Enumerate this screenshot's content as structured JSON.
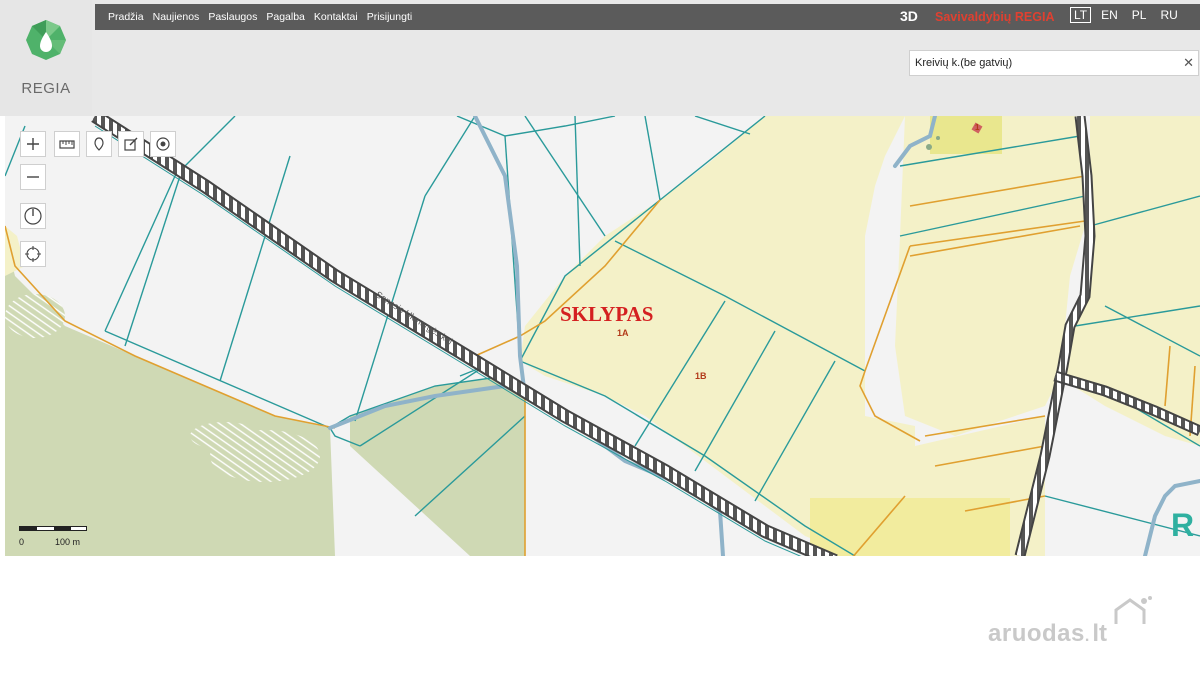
{
  "header": {
    "nav": [
      "Pradžia",
      "Naujienos",
      "Paslaugos",
      "Pagalba",
      "Kontaktai",
      "Prisijungti"
    ],
    "brand_3d": "3D",
    "brand_name": "Savivaldybių REGIA",
    "languages": [
      "LT",
      "EN",
      "PL",
      "RU"
    ],
    "active_language": "LT",
    "logo_text": "REGIA"
  },
  "search": {
    "value": "Kreivių k.(be gatvių)",
    "clear_icon": "close-icon"
  },
  "map": {
    "controls": {
      "top_row": [
        "zoom-in-icon",
        "measure-icon",
        "marker-icon",
        "edit-icon",
        "locate-icon"
      ],
      "column": [
        "zoom-out-icon",
        "compass-icon",
        "crosshair-icon"
      ]
    },
    "labels": {
      "plot_title": "SKLYPAS",
      "plot_1a": "1A",
      "plot_1b": "1B",
      "road_name": "Senasis Ukmergės kel",
      "small_label": "1"
    },
    "scale": {
      "start": "0",
      "end": "100 m"
    },
    "colors": {
      "plot_fill": "#f4f1c8",
      "forest_fill": "#cfd9b4",
      "boundary": "#2a9a9a",
      "highlight_boundary": "#e0a030",
      "annotation_red": "#d42020"
    }
  },
  "watermark": {
    "name": "aruodas",
    "dot": ".",
    "tld": "lt"
  }
}
